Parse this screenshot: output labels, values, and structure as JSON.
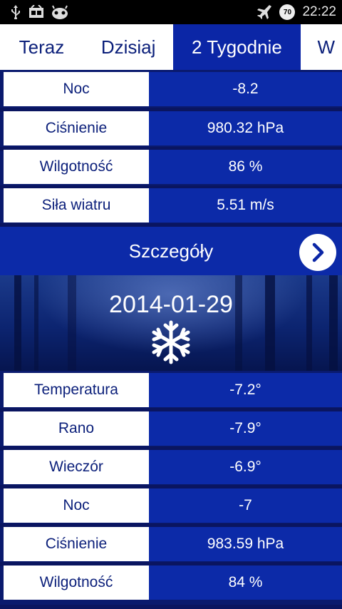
{
  "status_bar": {
    "left_icons": [
      "usb-icon",
      "notification-icon",
      "android-icon"
    ],
    "battery_level": "70",
    "time": "22:22"
  },
  "tabs": [
    {
      "label": "Teraz",
      "active": false
    },
    {
      "label": "Dzisiaj",
      "active": false
    },
    {
      "label": "2 Tygodnie",
      "active": true
    },
    {
      "label": "W",
      "active": false
    }
  ],
  "top_rows": [
    {
      "label": "Noc",
      "value": "-8.2"
    },
    {
      "label": "Ciśnienie",
      "value": "980.32 hPa"
    },
    {
      "label": "Wilgotność",
      "value": "86 %"
    },
    {
      "label": "Siła wiatru",
      "value": "5.51 m/s"
    }
  ],
  "details": {
    "label": "Szczegóły"
  },
  "day": {
    "date": "2014-01-29",
    "icon": "snowflake-icon"
  },
  "day_rows": [
    {
      "label": "Temperatura",
      "value": "-7.2°"
    },
    {
      "label": "Rano",
      "value": "-7.9°"
    },
    {
      "label": "Wieczór",
      "value": "-6.9°"
    },
    {
      "label": "Noc",
      "value": "-7"
    },
    {
      "label": "Ciśnienie",
      "value": "983.59 hPa"
    },
    {
      "label": "Wilgotność",
      "value": "84 %"
    }
  ],
  "colors": {
    "primary_blue": "#0c2aa8",
    "tab_text": "#0b1f7a",
    "background": "#0a1a6e"
  }
}
